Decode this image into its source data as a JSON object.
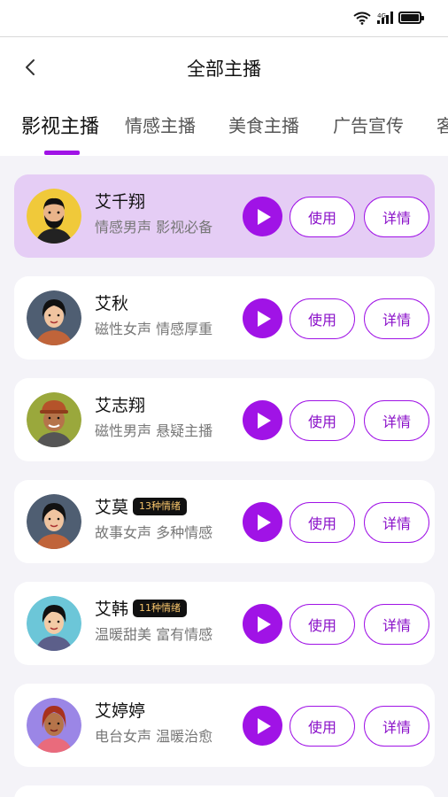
{
  "status_bar": {
    "network_label": "4G",
    "icons": [
      "wifi-icon",
      "signal-icon",
      "battery-icon"
    ]
  },
  "header": {
    "title": "全部主播",
    "back_icon": "chevron-left-icon"
  },
  "tabs": [
    {
      "label": "影视主播",
      "active": true
    },
    {
      "label": "情感主播",
      "active": false
    },
    {
      "label": "美食主播",
      "active": false
    },
    {
      "label": "广告宣传",
      "active": false
    },
    {
      "label": "客",
      "active": false
    }
  ],
  "accent_color": "#a013e6",
  "highlight_color": "#e5cdf5",
  "anchors": [
    {
      "name": "艾千翔",
      "badge": "",
      "desc": "情感男声 影视必备",
      "use_label": "使用",
      "detail_label": "详情",
      "avatar": "bearded-man-avatar",
      "highlighted": true
    },
    {
      "name": "艾秋",
      "badge": "",
      "desc": "磁性女声 情感厚重",
      "use_label": "使用",
      "detail_label": "详情",
      "avatar": "woman-avatar",
      "highlighted": false
    },
    {
      "name": "艾志翔",
      "badge": "",
      "desc": "磁性男声 悬疑主播",
      "use_label": "使用",
      "detail_label": "详情",
      "avatar": "man-with-cap-avatar",
      "highlighted": false
    },
    {
      "name": "艾莫",
      "badge": "13种情绪",
      "desc": "故事女声 多种情感",
      "use_label": "使用",
      "detail_label": "详情",
      "avatar": "woman-avatar",
      "highlighted": false
    },
    {
      "name": "艾韩",
      "badge": "11种情绪",
      "desc": "温暖甜美 富有情感",
      "use_label": "使用",
      "detail_label": "详情",
      "avatar": "woman-avatar",
      "highlighted": false
    },
    {
      "name": "艾婷婷",
      "badge": "",
      "desc": "电台女声 温暖治愈",
      "use_label": "使用",
      "detail_label": "详情",
      "avatar": "red-hair-woman-avatar",
      "highlighted": false
    }
  ]
}
